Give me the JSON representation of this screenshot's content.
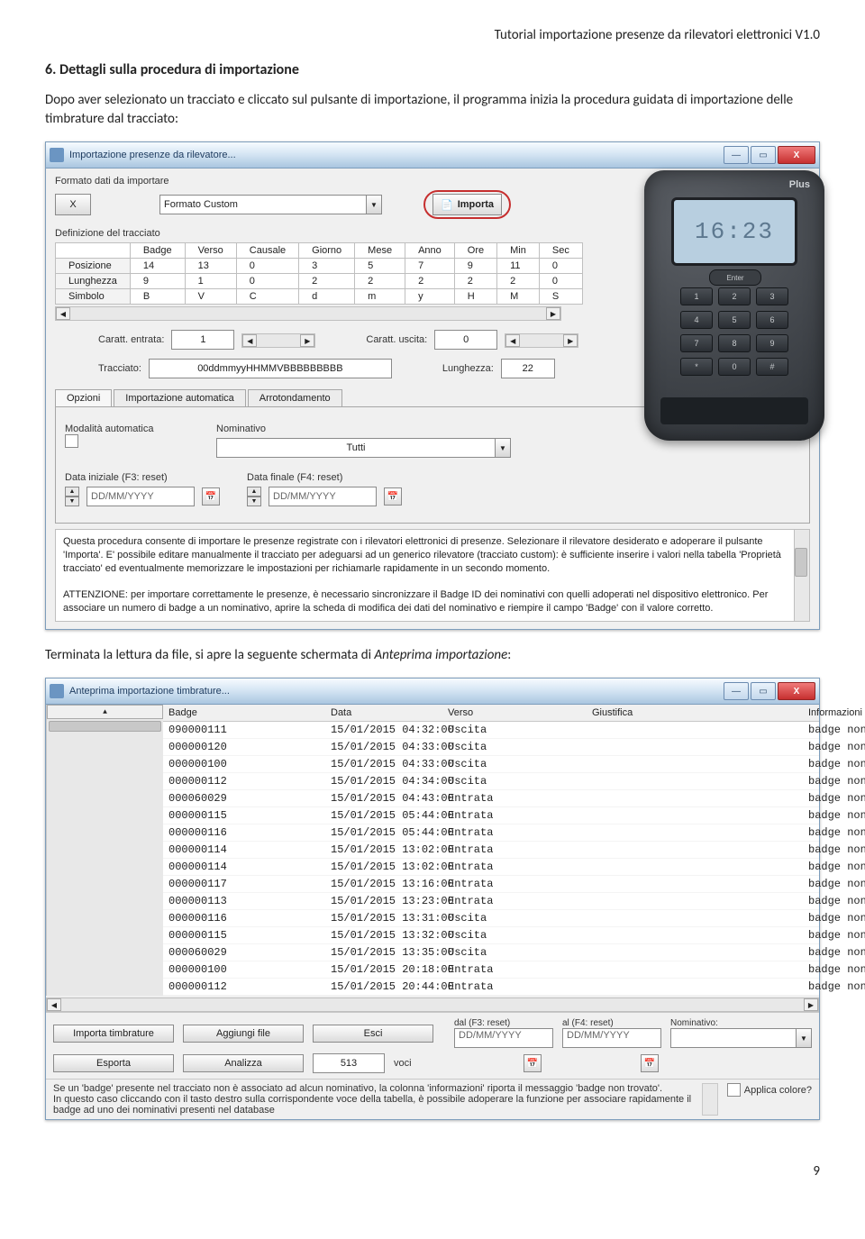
{
  "doc": {
    "header": "Tutorial importazione  presenze da rilevatori elettronici V1.0",
    "section_num": "6.",
    "section_title": "Dettagli sulla procedura di importazione",
    "para1": "Dopo aver selezionato un tracciato e cliccato sul pulsante di importazione, il programma inizia la procedura guidata di importazione delle timbrature dal tracciato:",
    "para2a": "Terminata la lettura da file, si apre la seguente schermata di ",
    "para2b": "Anteprima importazione",
    "para2c": ":",
    "page_number": "9"
  },
  "win1": {
    "title": "Importazione presenze da rilevatore...",
    "formato_lbl": "Formato dati da importare",
    "x_btn": "X",
    "formato_value": "Formato Custom",
    "importa_btn": "Importa",
    "def_lbl": "Definizione del tracciato",
    "cols": [
      "",
      "Badge",
      "Verso",
      "Causale",
      "Giorno",
      "Mese",
      "Anno",
      "Ore",
      "Min",
      "Sec"
    ],
    "rows": [
      [
        "Posizione",
        "14",
        "13",
        "0",
        "3",
        "5",
        "7",
        "9",
        "11",
        "0"
      ],
      [
        "Lunghezza",
        "9",
        "1",
        "0",
        "2",
        "2",
        "2",
        "2",
        "2",
        "0"
      ],
      [
        "Simbolo",
        "B",
        "V",
        "C",
        "d",
        "m",
        "y",
        "H",
        "M",
        "S"
      ]
    ],
    "caratt_entrata_lbl": "Caratt. entrata:",
    "caratt_entrata_val": "1",
    "caratt_uscita_lbl": "Caratt. uscita:",
    "caratt_uscita_val": "0",
    "tracciato_lbl": "Tracciato:",
    "tracciato_val": "00ddmmyyHHMMVBBBBBBBBB",
    "lunghezza_lbl": "Lunghezza:",
    "lunghezza_val": "22",
    "tab_opzioni": "Opzioni",
    "tab_importauto": "Importazione automatica",
    "tab_arrot": "Arrotondamento",
    "modalita_lbl": "Modalità automatica",
    "nominativo_lbl": "Nominativo",
    "nominativo_val": "Tutti",
    "data_iniziale_lbl": "Data iniziale (F3: reset)",
    "data_finale_lbl": "Data finale (F4: reset)",
    "date_placeholder": "DD/MM/YYYY",
    "help1": "Questa procedura consente di importare le presenze registrate con i rilevatori elettronici di presenze. Selezionare il rilevatore desiderato e adoperare il pulsante 'Importa'. E' possibile editare manualmente il tracciato per adeguarsi ad un generico rilevatore (tracciato custom): è sufficiente inserire i valori nella tabella 'Proprietà tracciato' ed eventualmente memorizzare le impostazioni per richiamarle rapidamente in un secondo momento.",
    "help2": "ATTENZIONE: per importare correttamente le presenze, è necessario sincronizzare il Badge ID dei nominativi con quelli adoperati nel dispositivo elettronico. Per associare un numero di badge a un nominativo, aprire la scheda di modifica dei dati del nominativo e riempire il campo 'Badge' con il valore corretto."
  },
  "device": {
    "brand": "Plus",
    "time": "16:23",
    "enter": "Enter",
    "keys": [
      "1",
      "2",
      "3",
      "4",
      "5",
      "6",
      "7",
      "8",
      "9",
      "*",
      "0",
      "#"
    ]
  },
  "win2": {
    "title": "Anteprima importazione timbrature...",
    "headers": [
      "Badge",
      "Data",
      "Verso",
      "Giustifica",
      "Informazioni"
    ],
    "rows": [
      [
        "090000111",
        "15/01/2015 04:32:00",
        "Uscita",
        "",
        "badge non trovato"
      ],
      [
        "000000120",
        "15/01/2015 04:33:00",
        "Uscita",
        "",
        "badge non trovato"
      ],
      [
        "000000100",
        "15/01/2015 04:33:00",
        "Uscita",
        "",
        "badge non trovato"
      ],
      [
        "000000112",
        "15/01/2015 04:34:00",
        "Uscita",
        "",
        "badge non trovato"
      ],
      [
        "000060029",
        "15/01/2015 04:43:00",
        "Entrata",
        "",
        "badge non trovato"
      ],
      [
        "000000115",
        "15/01/2015 05:44:00",
        "Entrata",
        "",
        "badge non trovato"
      ],
      [
        "000000116",
        "15/01/2015 05:44:00",
        "Entrata",
        "",
        "badge non trovato"
      ],
      [
        "000000114",
        "15/01/2015 13:02:00",
        "Entrata",
        "",
        "badge non trovato"
      ],
      [
        "000000114",
        "15/01/2015 13:02:00",
        "Entrata",
        "",
        "badge non trovato"
      ],
      [
        "000000117",
        "15/01/2015 13:16:00",
        "Entrata",
        "",
        "badge non trovato"
      ],
      [
        "000000113",
        "15/01/2015 13:23:00",
        "Entrata",
        "",
        "badge non trovato"
      ],
      [
        "000000116",
        "15/01/2015 13:31:00",
        "Uscita",
        "",
        "badge non trovato"
      ],
      [
        "000000115",
        "15/01/2015 13:32:00",
        "Uscita",
        "",
        "badge non trovato"
      ],
      [
        "000060029",
        "15/01/2015 13:35:00",
        "Uscita",
        "",
        "badge non trovato"
      ],
      [
        "000000100",
        "15/01/2015 20:18:00",
        "Entrata",
        "",
        "badge non trovato"
      ],
      [
        "000000112",
        "15/01/2015 20:44:00",
        "Entrata",
        "",
        "badge non trovato"
      ]
    ],
    "btn_import": "Importa timbrature",
    "btn_addfile": "Aggiungi file",
    "btn_esci": "Esci",
    "btn_esporta": "Esporta",
    "btn_analizza": "Analizza",
    "count_val": "513",
    "count_lbl": "voci",
    "dal_lbl": "dal (F3: reset)",
    "al_lbl": "al (F4: reset)",
    "nom_lbl": "Nominativo:",
    "date_ph": "DD/MM/YYYY",
    "info1": "Se un 'badge' presente nel tracciato non è associato ad alcun nominativo, la colonna 'informazioni' riporta il messaggio 'badge non trovato'.",
    "info2": "In questo caso cliccando con il tasto destro sulla corrispondente voce della tabella, è possibile adoperare la funzione per associare rapidamente il badge ad uno dei nominativi presenti nel database",
    "applica_colore": "Applica colore?"
  }
}
